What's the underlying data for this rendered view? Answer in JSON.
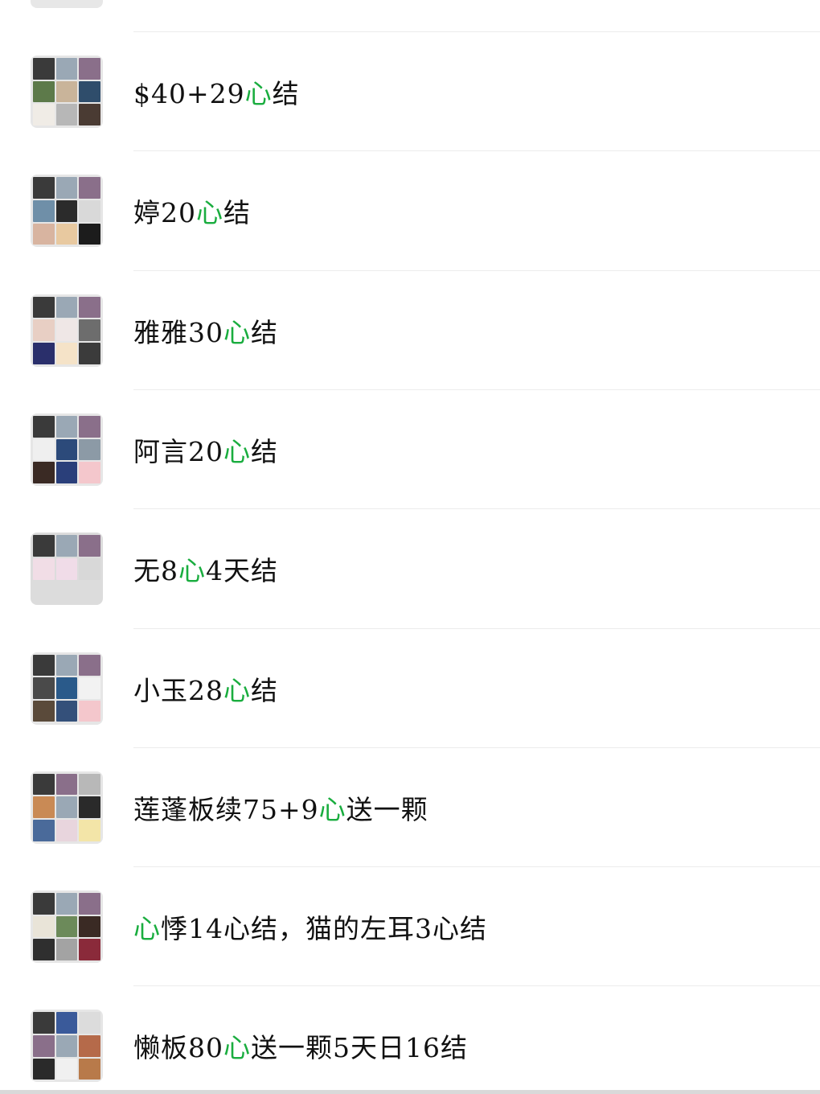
{
  "chats": [
    {
      "name_parts": [
        {
          "t": "$40+29"
        },
        {
          "t": "心",
          "accent": true
        },
        {
          "t": "结"
        }
      ]
    },
    {
      "name_parts": [
        {
          "t": "婷20"
        },
        {
          "t": "心",
          "accent": true
        },
        {
          "t": "结"
        }
      ]
    },
    {
      "name_parts": [
        {
          "t": "雅雅30"
        },
        {
          "t": "心",
          "accent": true
        },
        {
          "t": "结"
        }
      ]
    },
    {
      "name_parts": [
        {
          "t": "阿言20"
        },
        {
          "t": "心",
          "accent": true
        },
        {
          "t": "结"
        }
      ]
    },
    {
      "name_parts": [
        {
          "t": "无8"
        },
        {
          "t": "心",
          "accent": true
        },
        {
          "t": "4天结"
        }
      ]
    },
    {
      "name_parts": [
        {
          "t": "小玉28"
        },
        {
          "t": "心",
          "accent": true
        },
        {
          "t": "结"
        }
      ]
    },
    {
      "name_parts": [
        {
          "t": "莲蓬板续75+9"
        },
        {
          "t": "心",
          "accent": true
        },
        {
          "t": "送一颗"
        }
      ]
    },
    {
      "name_parts": [
        {
          "t": "心",
          "accent": true
        },
        {
          "t": "悸14心结，猫的左耳3心结"
        }
      ]
    },
    {
      "name_parts": [
        {
          "t": "懒板80"
        },
        {
          "t": "心",
          "accent": true
        },
        {
          "t": "送一颗5天日16结"
        }
      ]
    }
  ],
  "colors": {
    "accent": "#1aad3f",
    "text": "#111111",
    "divider": "#ececec"
  },
  "avatar_icon": "group-avatar-grid-icon"
}
